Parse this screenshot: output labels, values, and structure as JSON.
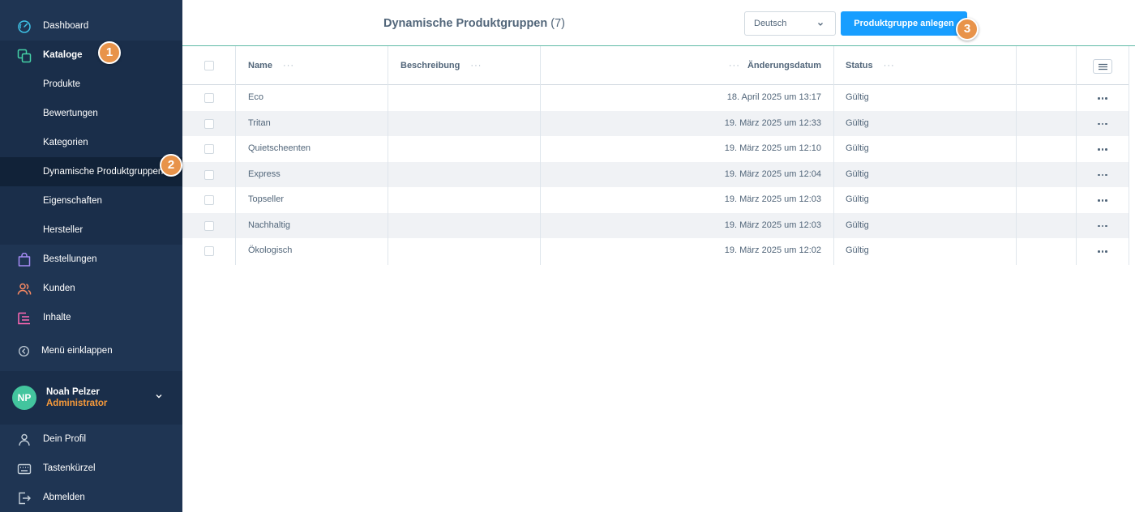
{
  "sidebar": {
    "main_top": [
      {
        "label": "Dashboard",
        "icon": "dashboard-icon"
      },
      {
        "label": "Kataloge",
        "icon": "catalog-icon"
      }
    ],
    "catalog_sub": [
      {
        "label": "Produkte"
      },
      {
        "label": "Bewertungen"
      },
      {
        "label": "Kategorien"
      },
      {
        "label": "Dynamische Produktgruppen"
      },
      {
        "label": "Eigenschaften"
      },
      {
        "label": "Hersteller"
      }
    ],
    "main_bottom": [
      {
        "label": "Bestellungen",
        "icon": "orders-icon"
      },
      {
        "label": "Kunden",
        "icon": "customers-icon"
      },
      {
        "label": "Inhalte",
        "icon": "content-icon"
      }
    ],
    "collapse_label": "Menü einklappen",
    "user": {
      "initials": "NP",
      "name": "Noah Pelzer",
      "role": "Administrator"
    },
    "account": [
      {
        "label": "Dein Profil",
        "icon": "user-icon"
      },
      {
        "label": "Tastenkürzel",
        "icon": "keyboard-icon"
      },
      {
        "label": "Abmelden",
        "icon": "logout-icon"
      }
    ]
  },
  "badges": [
    "1",
    "2",
    "3"
  ],
  "header": {
    "title": "Dynamische Produktgruppen",
    "count": "(7)",
    "language": "Deutsch",
    "create_button": "Produktgruppe anlegen"
  },
  "table": {
    "columns": {
      "name": "Name",
      "description": "Beschreibung",
      "date": "Änderungsdatum",
      "status": "Status"
    },
    "col_menu": "···",
    "rows": [
      {
        "name": "Eco",
        "description": "",
        "date": "18. April 2025 um 13:17",
        "status": "Gültig"
      },
      {
        "name": "Tritan",
        "description": "",
        "date": "19. März 2025 um 12:33",
        "status": "Gültig"
      },
      {
        "name": "Quietscheenten",
        "description": "",
        "date": "19. März 2025 um 12:10",
        "status": "Gültig"
      },
      {
        "name": "Express",
        "description": "",
        "date": "19. März 2025 um 12:04",
        "status": "Gültig"
      },
      {
        "name": "Topseller",
        "description": "",
        "date": "19. März 2025 um 12:03",
        "status": "Gültig"
      },
      {
        "name": "Nachhaltig",
        "description": "",
        "date": "19. März 2025 um 12:03",
        "status": "Gültig"
      },
      {
        "name": "Ökologisch",
        "description": "",
        "date": "19. März 2025 um 12:02",
        "status": "Gültig"
      }
    ]
  },
  "colors": {
    "sidebar_bg": "#1f3553",
    "accent_blue": "#189eff",
    "badge_orange": "#e8934a",
    "avatar_green": "#43c59e",
    "role_orange": "#f79a3a",
    "header_line": "#5fb9a6"
  }
}
